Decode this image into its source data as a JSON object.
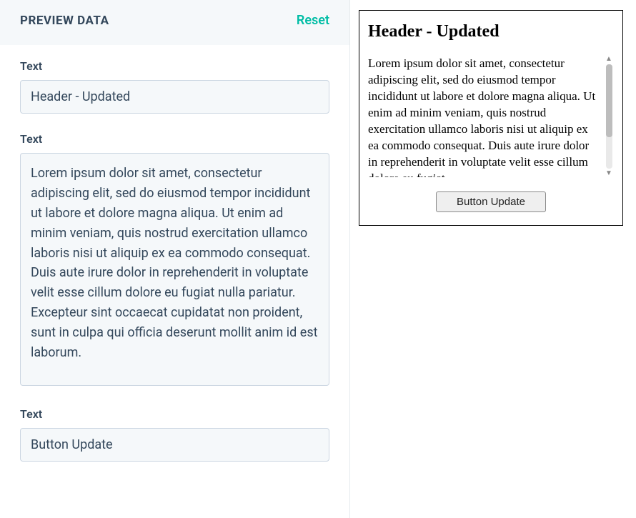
{
  "panel": {
    "title": "PREVIEW DATA",
    "reset_label": "Reset"
  },
  "fields": {
    "header": {
      "label": "Text",
      "value": "Header - Updated"
    },
    "body": {
      "label": "Text",
      "value": "Lorem ipsum dolor sit amet, consectetur adipiscing elit, sed do eiusmod tempor incididunt ut labore et dolore magna aliqua. Ut enim ad minim veniam, quis nostrud exercitation ullamco laboris nisi ut aliquip ex ea commodo consequat. Duis aute irure dolor in reprehenderit in voluptate velit esse cillum dolore eu fugiat nulla pariatur. Excepteur sint occaecat cupidatat non proident, sunt in culpa qui officia deserunt mollit anim id est laborum."
    },
    "button": {
      "label": "Text",
      "value": "Button Update"
    }
  },
  "preview": {
    "header": "Header - Updated",
    "body": "Lorem ipsum dolor sit amet, consectetur adipiscing elit, sed do eiusmod tempor incididunt ut labore et dolore magna aliqua. Ut enim ad minim veniam, quis nostrud exercitation ullamco laboris nisi ut aliquip ex ea commodo consequat. Duis aute irure dolor in reprehenderit in voluptate velit esse cillum dolore eu fugiat",
    "button_label": "Button Update"
  }
}
